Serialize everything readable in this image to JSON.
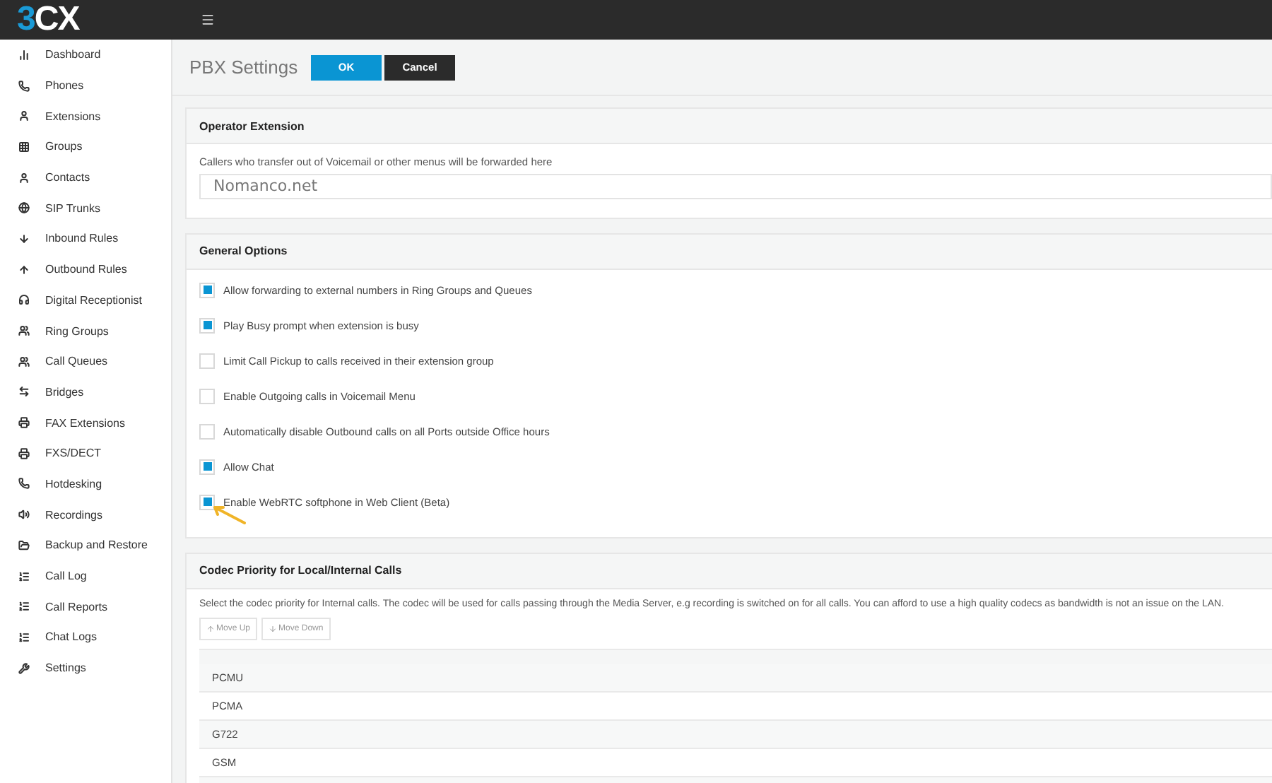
{
  "header": {
    "logo_accent": "3",
    "logo_rest": "CX"
  },
  "sidebar": {
    "items": [
      {
        "label": "Dashboard"
      },
      {
        "label": "Phones"
      },
      {
        "label": "Extensions"
      },
      {
        "label": "Groups"
      },
      {
        "label": "Contacts"
      },
      {
        "label": "SIP Trunks"
      },
      {
        "label": "Inbound Rules"
      },
      {
        "label": "Outbound Rules"
      },
      {
        "label": "Digital Receptionist"
      },
      {
        "label": "Ring Groups"
      },
      {
        "label": "Call Queues"
      },
      {
        "label": "Bridges"
      },
      {
        "label": "FAX Extensions"
      },
      {
        "label": "FXS/DECT"
      },
      {
        "label": "Hotdesking"
      },
      {
        "label": "Recordings"
      },
      {
        "label": "Backup and Restore"
      },
      {
        "label": "Call Log"
      },
      {
        "label": "Call Reports"
      },
      {
        "label": "Chat Logs"
      },
      {
        "label": "Settings"
      }
    ]
  },
  "page": {
    "title": "PBX Settings",
    "buttons": [
      {
        "label": "OK",
        "kind": "primary"
      },
      {
        "label": "Cancel",
        "kind": "dark"
      }
    ]
  },
  "operator_extension": {
    "title": "Operator Extension",
    "description": "Callers who transfer out of Voicemail or other menus will be forwarded here",
    "value": "Nomanco.net"
  },
  "general_options": {
    "title": "General Options",
    "options": [
      {
        "label": "Allow forwarding to external numbers in Ring Groups and Queues",
        "checked": true
      },
      {
        "label": "Play Busy prompt when extension is busy",
        "checked": true
      },
      {
        "label": "Limit Call Pickup to calls received in their extension group",
        "checked": false
      },
      {
        "label": "Enable Outgoing calls in Voicemail Menu",
        "checked": false
      },
      {
        "label": "Automatically disable Outbound calls on all Ports outside Office hours",
        "checked": false
      },
      {
        "label": "Allow Chat",
        "checked": true
      },
      {
        "label": "Enable WebRTC softphone in Web Client (Beta)",
        "checked": true
      }
    ]
  },
  "codec_priority": {
    "title": "Codec Priority for Local/Internal Calls",
    "description": "Select the codec priority for Internal calls. The codec will be used for calls passing through the Media Server, e.g recording is switched on for all calls. You can afford to use a high quality codecs as bandwidth is not an issue on the LAN.",
    "buttons": [
      {
        "label": "Move Up",
        "kind": "up"
      },
      {
        "label": "Move Down",
        "kind": "down"
      }
    ],
    "codecs": [
      "PCMU",
      "PCMA",
      "G722",
      "GSM"
    ]
  }
}
